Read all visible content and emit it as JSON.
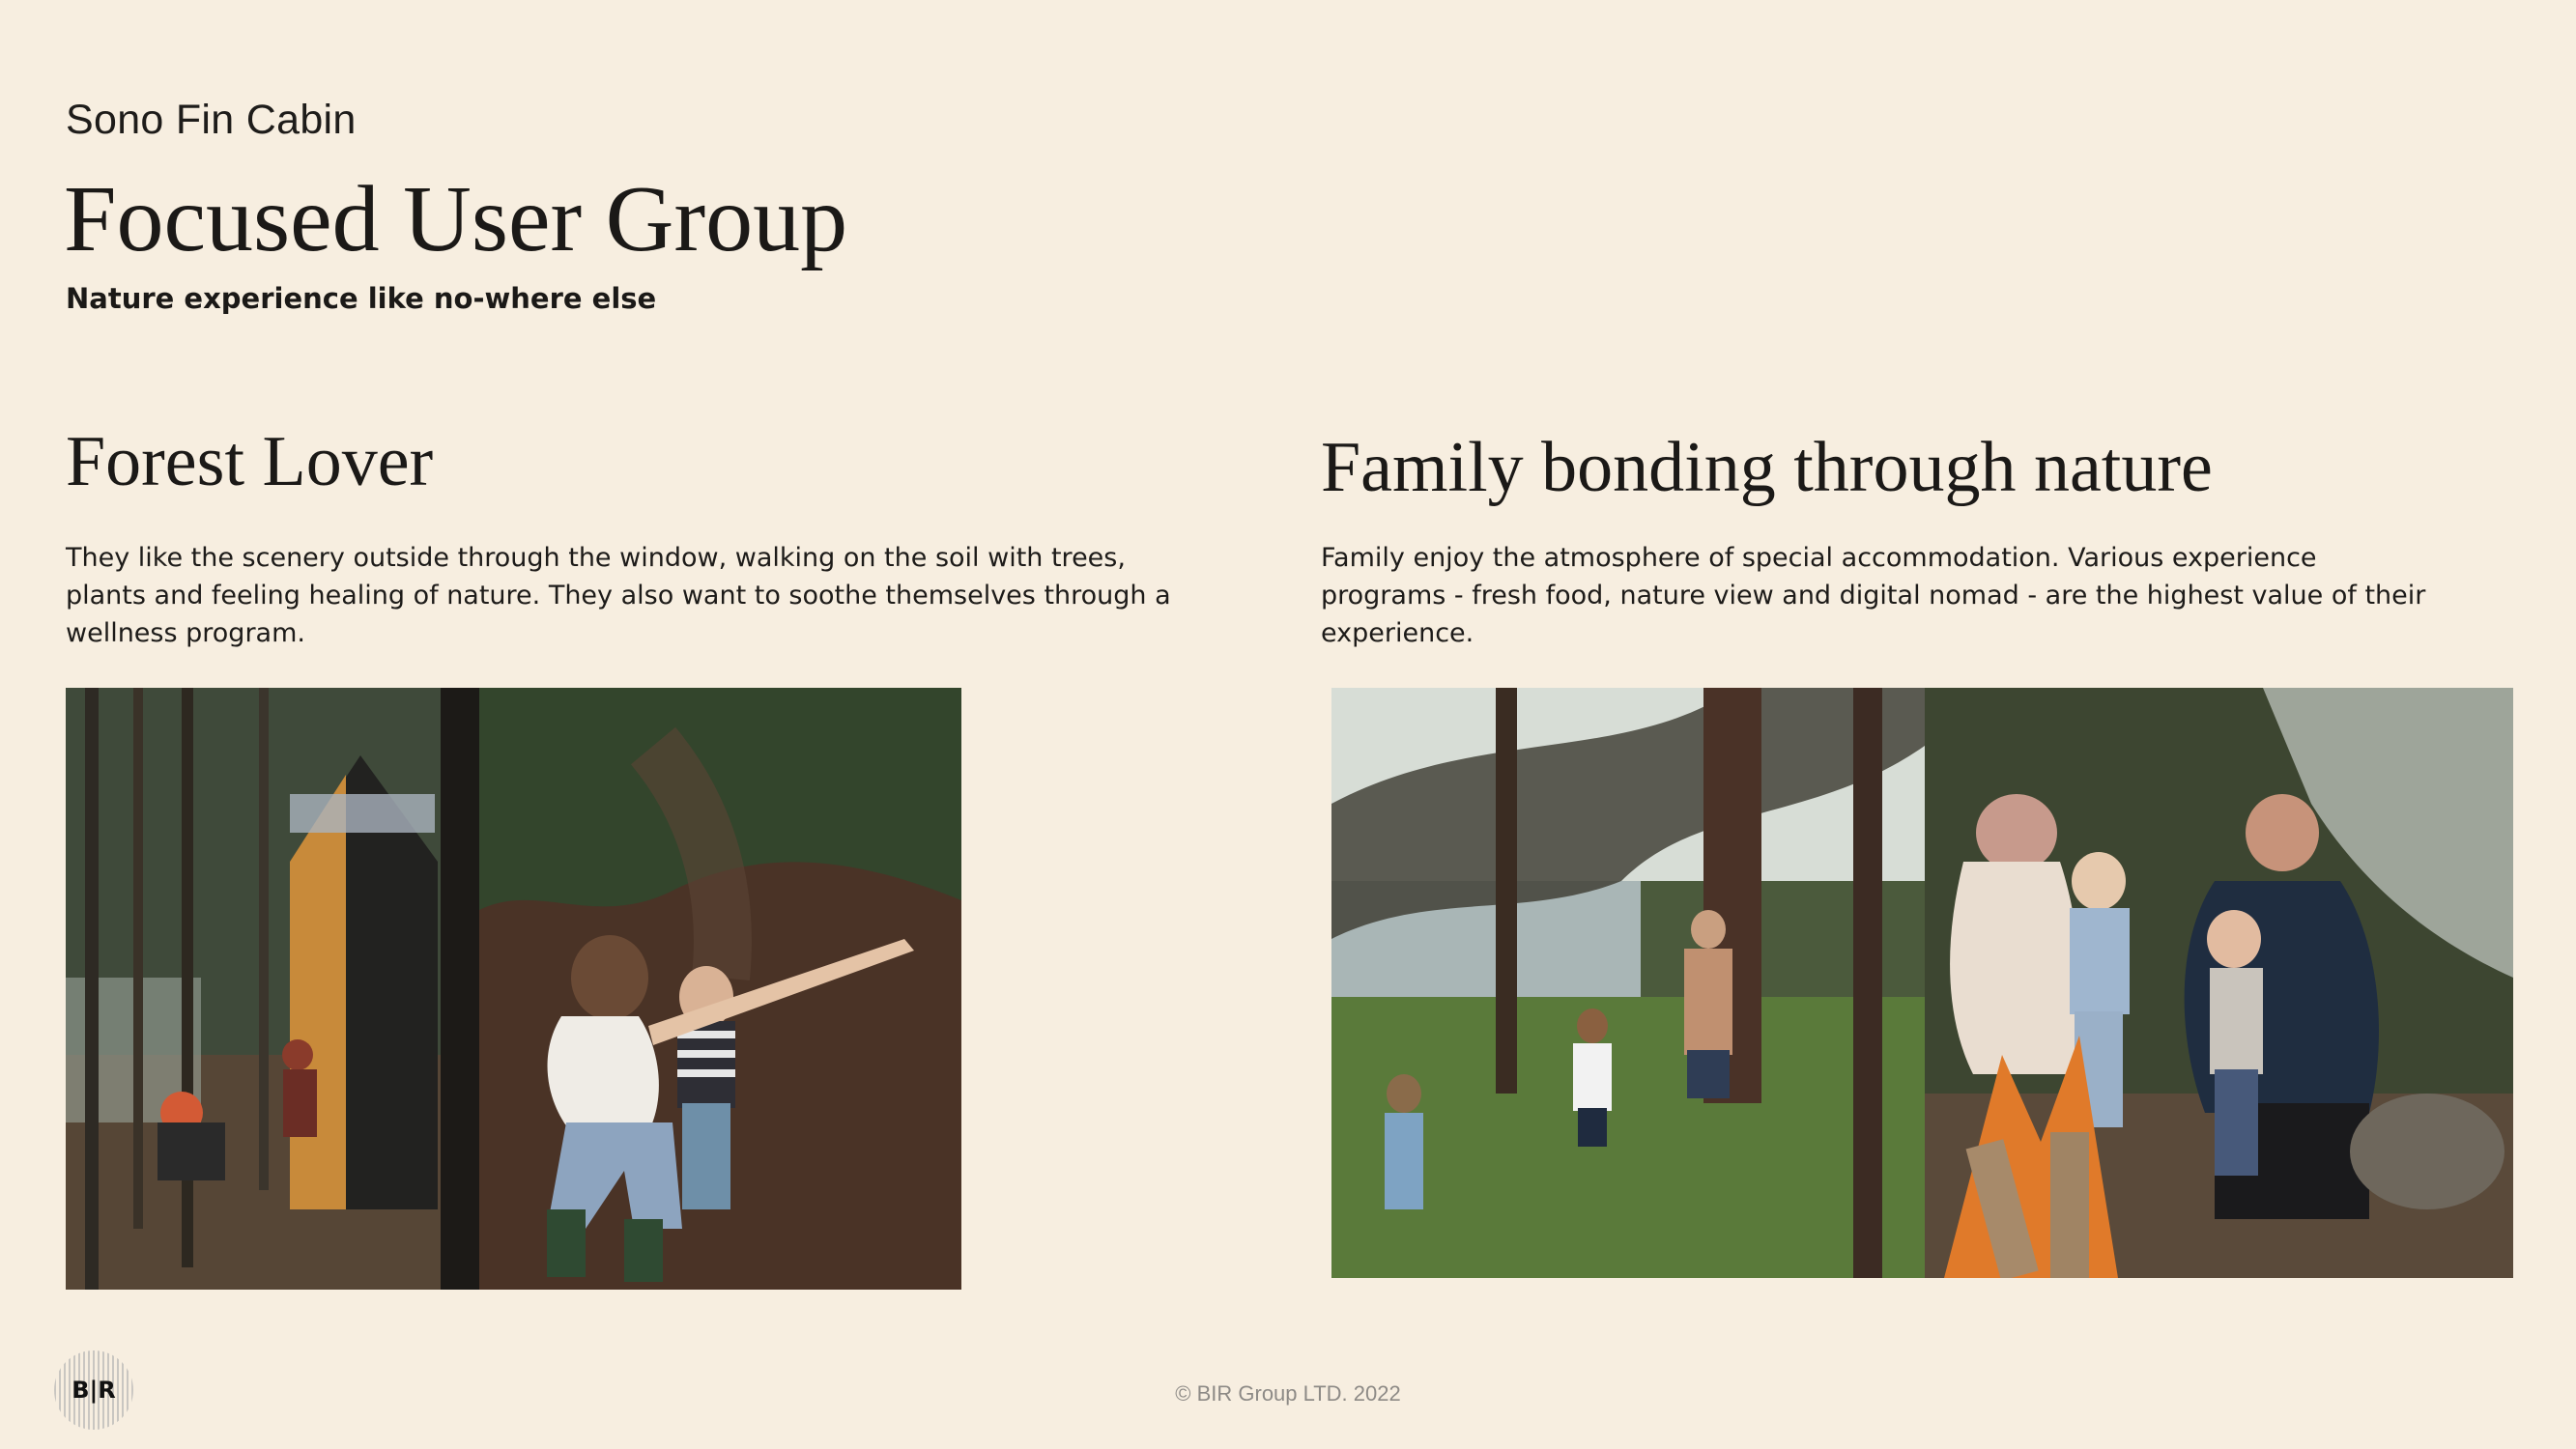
{
  "header": {
    "project_name": "Sono Fin Cabin",
    "title": "Focused User Group",
    "tagline": "Nature experience like no-where else"
  },
  "sections": {
    "left": {
      "title": "Forest Lover",
      "body": "They like the scenery outside through the window, walking on the soil with trees, plants and feeling healing of nature. They also want to soothe themselves through a wellness program."
    },
    "right": {
      "title": "Family bonding through nature",
      "body": "Family enjoy the atmosphere of special accommodation. Various experience programs - fresh food, nature view and digital nomad - are the highest value of their experience."
    }
  },
  "footer": {
    "logo_text": "B|R",
    "copyright": "© BIR Group LTD. 2022"
  },
  "colors": {
    "background": "#f7eee0",
    "text": "#1b1917",
    "muted": "#8d8a86"
  },
  "icons": {
    "logo": "bir-logo-icon"
  }
}
